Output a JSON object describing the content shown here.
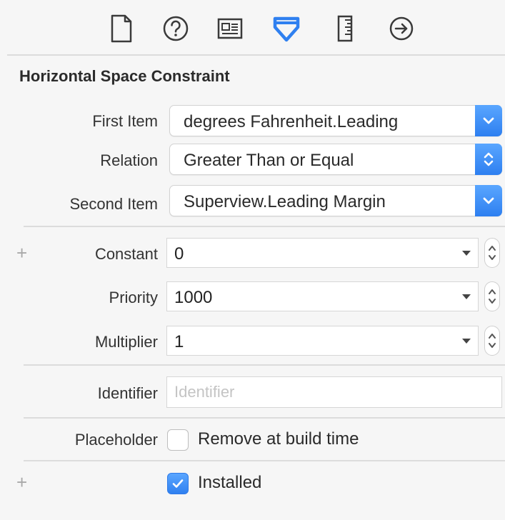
{
  "toolbar": {
    "icons": [
      "file-icon",
      "help-icon",
      "identity-card-icon",
      "attributes-icon",
      "ruler-icon",
      "connections-icon"
    ],
    "active_icon": "attributes-icon",
    "accent_color": "#2f80f0"
  },
  "inspector": {
    "title": "Horizontal Space Constraint",
    "first_item": {
      "label": "First Item",
      "value": "degrees Fahrenheit.Leading"
    },
    "relation": {
      "label": "Relation",
      "value": "Greater Than or Equal"
    },
    "second_item": {
      "label": "Second Item",
      "value": "Superview.Leading Margin"
    },
    "constant": {
      "label": "Constant",
      "value": "0"
    },
    "priority": {
      "label": "Priority",
      "value": "1000"
    },
    "multiplier": {
      "label": "Multiplier",
      "value": "1"
    },
    "identifier": {
      "label": "Identifier",
      "value": "",
      "placeholder": "Identifier"
    },
    "placeholder_option": {
      "label": "Placeholder",
      "checkbox_label": "Remove at build time",
      "checked": false
    },
    "installed": {
      "label": "Installed",
      "checked": true
    },
    "plus_symbol": "+"
  }
}
